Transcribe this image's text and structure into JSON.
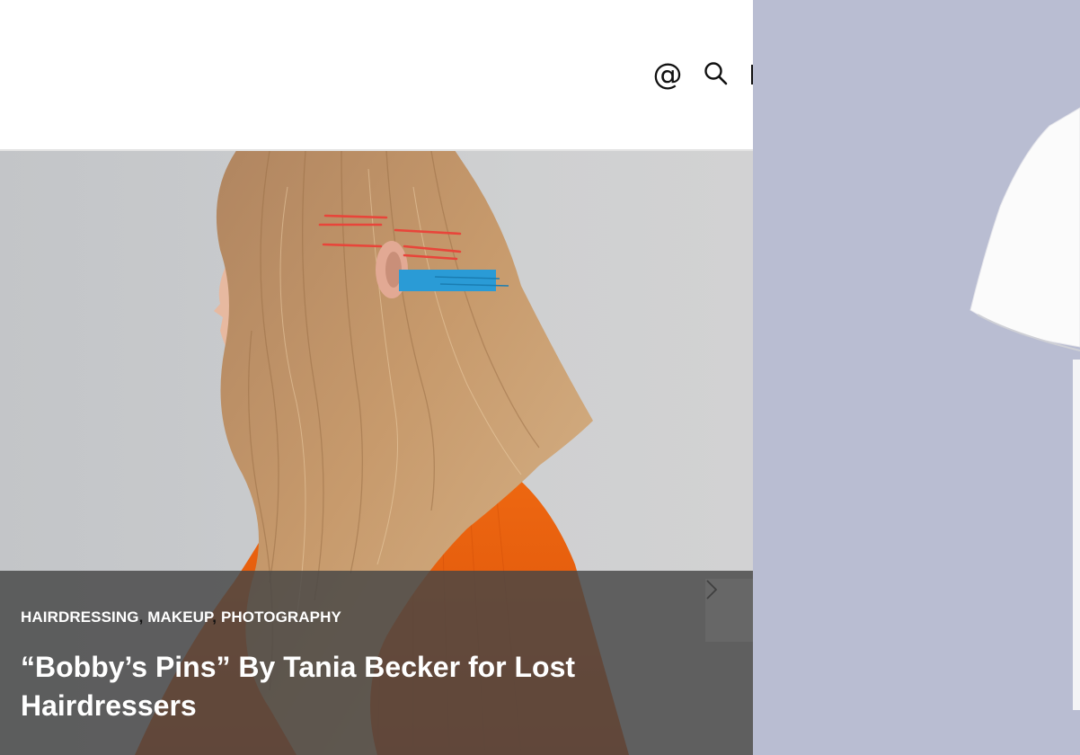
{
  "header": {
    "at_icon_glyph": "@",
    "icons": [
      "at-sign-icon",
      "search-icon",
      "menu-icon"
    ]
  },
  "hero": {
    "categories": [
      "HAIRDRESSING",
      "MAKEUP",
      "PHOTOGRAPHY"
    ],
    "separator": ",",
    "title": "“Bobby’s Pins” By Tania Becker for Lost Hairdressers",
    "next_icon": "chevron-right-icon"
  },
  "colors": {
    "caption_overlay": "#464646",
    "side_panel": "#b9bdd2",
    "sweater": "#e85a0c",
    "pins": "#e8453a",
    "clip": "#2a9bd6"
  }
}
